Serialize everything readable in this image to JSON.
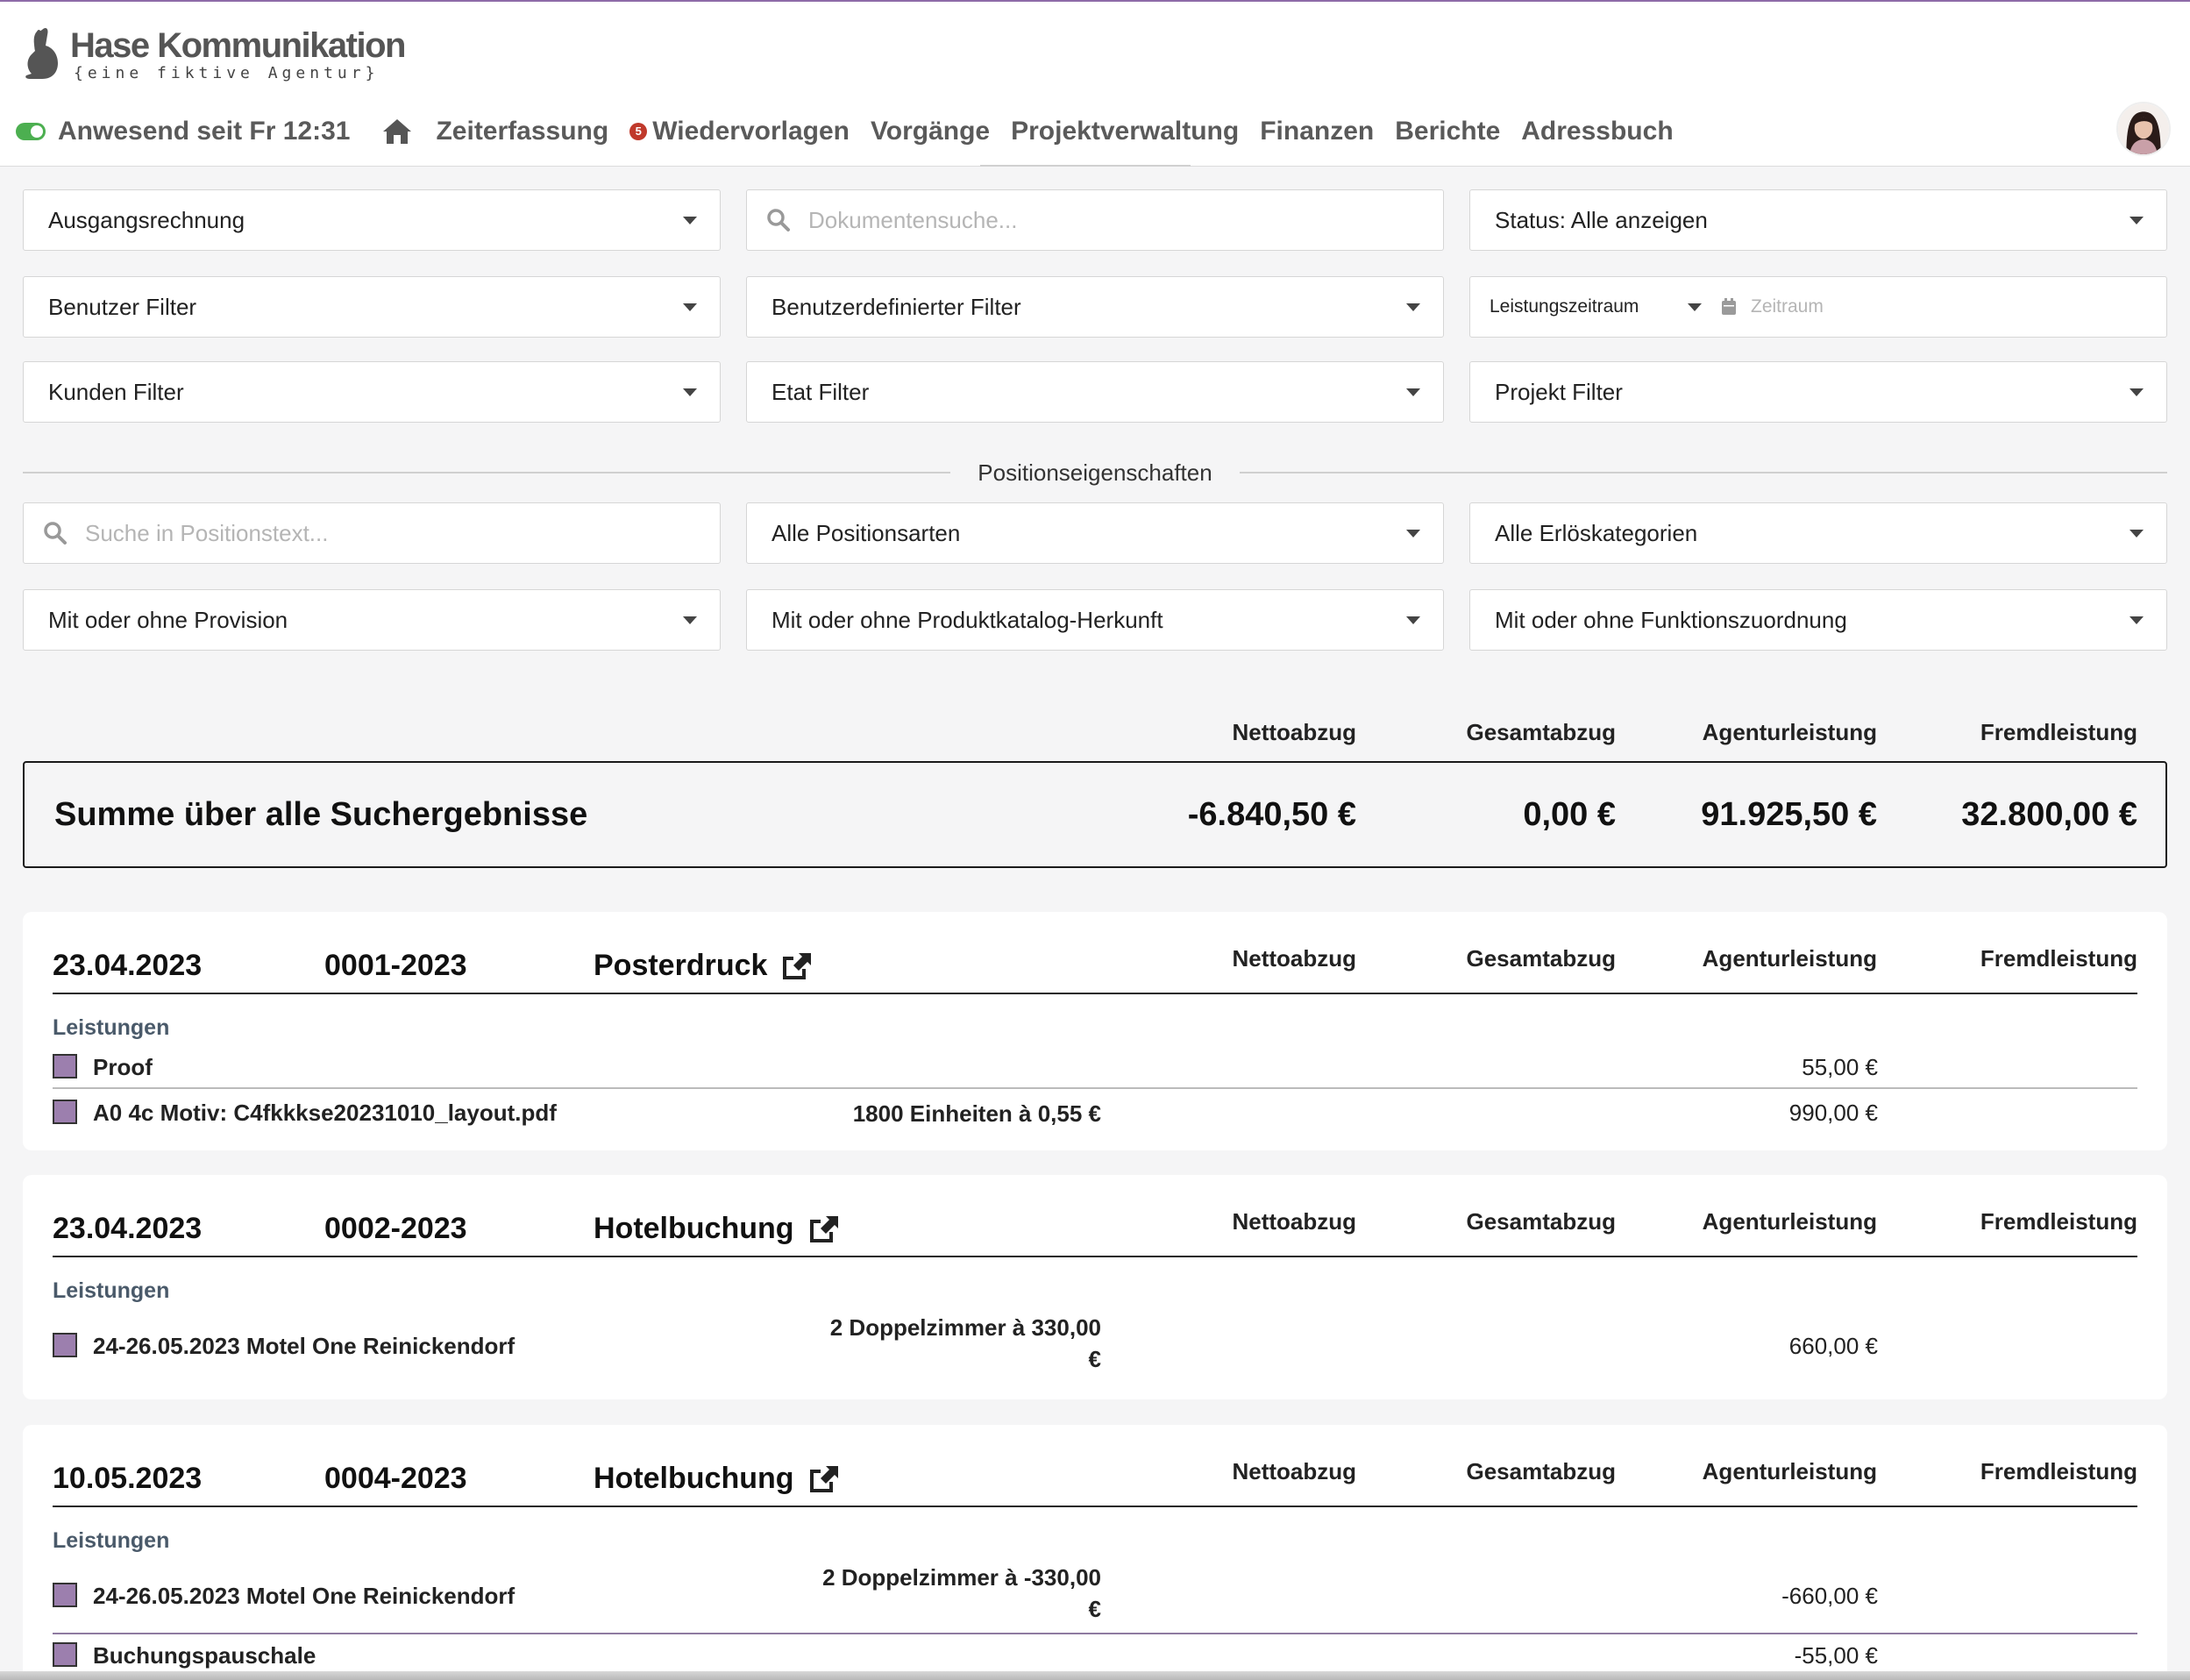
{
  "brand": {
    "name": "Hase Kommunikation",
    "tagline": "{eine fiktive Agentur}"
  },
  "nav": {
    "presence": "Anwesend seit Fr 12:31",
    "items": [
      "Zeiterfassung",
      "Wiedervorlagen",
      "Vorgänge",
      "Projektverwaltung",
      "Finanzen",
      "Berichte",
      "Adressbuch"
    ],
    "badge_count": "5"
  },
  "filters": {
    "doctype": "Ausgangsrechnung",
    "search_placeholder": "Dokumentensuche...",
    "status": "Status: Alle anzeigen",
    "user_filter": "Benutzer Filter",
    "custom_filter": "Benutzerdefinierter Filter",
    "period_type": "Leistungszeitraum",
    "period_placeholder": "Zeitraum",
    "customer_filter": "Kunden Filter",
    "budget_filter": "Etat Filter",
    "project_filter": "Projekt Filter"
  },
  "position_props": {
    "label": "Positionseigenschaften",
    "search_placeholder": "Suche in Positionstext...",
    "types": "Alle Positionsarten",
    "revenue": "Alle Erlöskategorien",
    "commission": "Mit oder ohne Provision",
    "catalog": "Mit oder ohne Produktkatalog-Herkunft",
    "function": "Mit oder ohne Funktionszuordnung"
  },
  "columns": [
    "Nettoabzug",
    "Gesamtabzug",
    "Agenturleistung",
    "Fremdleistung"
  ],
  "summary": {
    "label": "Summe über alle Suchergebnisse",
    "values": [
      "-6.840,50 €",
      "0,00 €",
      "91.925,50 €",
      "32.800,00 €"
    ]
  },
  "documents": [
    {
      "date": "23.04.2023",
      "number": "0001-2023",
      "title": "Posterdruck",
      "section": "Leistungen",
      "positions": [
        {
          "name": "Proof",
          "qty": "",
          "agency": "55,00 €"
        },
        {
          "name": "A0 4c Motiv: C4fkkkse20231010_layout.pdf",
          "qty": "1800 Einheiten à 0,55 €",
          "agency": "990,00 €"
        }
      ]
    },
    {
      "date": "23.04.2023",
      "number": "0002-2023",
      "title": "Hotelbuchung",
      "section": "Leistungen",
      "positions": [
        {
          "name": "24-26.05.2023 Motel One Reinickendorf",
          "qty_line1": "2 Doppelzimmer à 330,00",
          "qty_line2": "€",
          "agency": "660,00 €"
        }
      ]
    },
    {
      "date": "10.05.2023",
      "number": "0004-2023",
      "title": "Hotelbuchung",
      "section": "Leistungen",
      "positions": [
        {
          "name": "24-26.05.2023 Motel One Reinickendorf",
          "qty_line1": "2 Doppelzimmer à -330,00",
          "qty_line2": "€",
          "agency": "-660,00 €"
        },
        {
          "name": "Buchungspauschale",
          "qty": "",
          "agency": "-55,00 €"
        }
      ]
    }
  ]
}
